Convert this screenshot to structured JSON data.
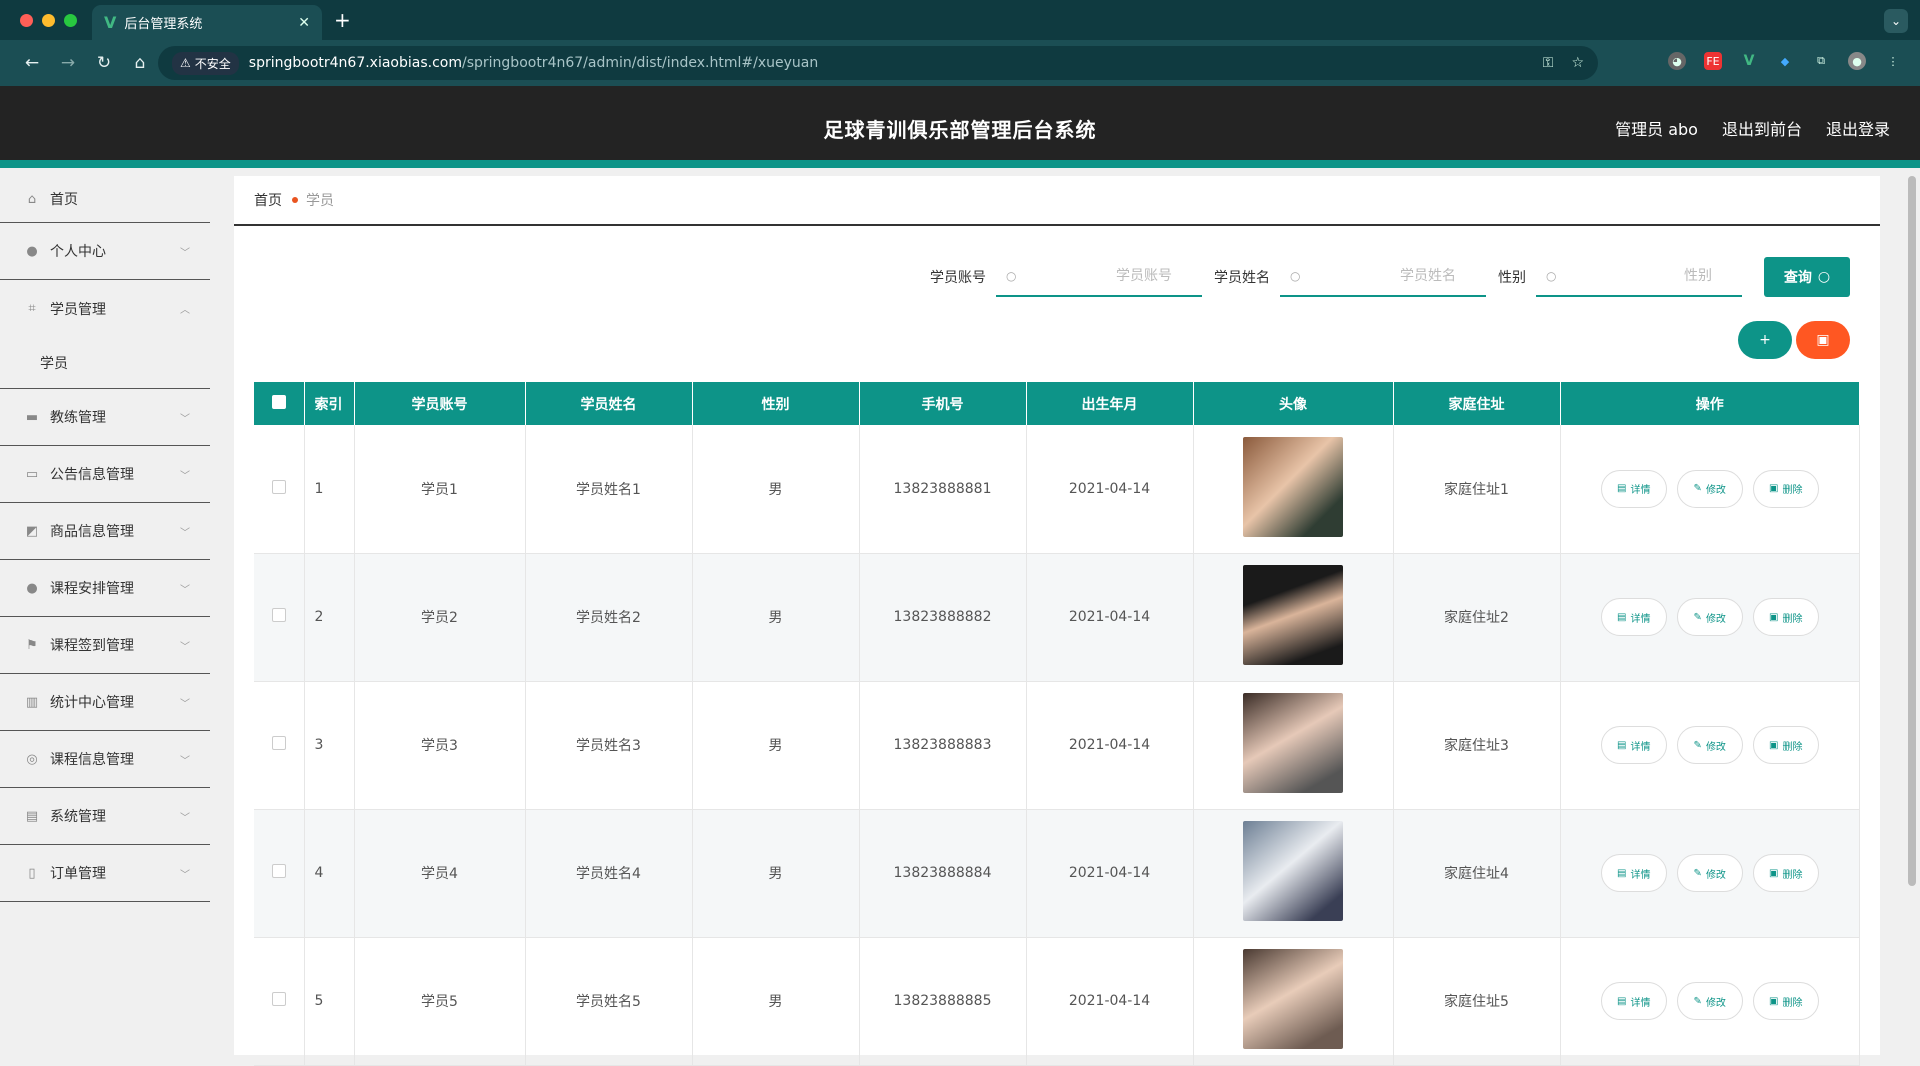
{
  "browser": {
    "tab_title": "后台管理系统",
    "insecure_label": "不安全",
    "url_host": "springbootr4n67.xiaobias.com",
    "url_path": "/springbootr4n67/admin/dist/index.html#/xueyuan"
  },
  "header": {
    "title": "足球青训俱乐部管理后台系统",
    "admin_label": "管理员 abo",
    "to_front": "退出到前台",
    "logout": "退出登录"
  },
  "sidebar": {
    "home": "首页",
    "personal": "个人中心",
    "student_mgmt": "学员管理",
    "student_sub": "学员",
    "coach": "教练管理",
    "notice": "公告信息管理",
    "goods": "商品信息管理",
    "course_schedule": "课程安排管理",
    "checkin": "课程签到管理",
    "stats": "统计中心管理",
    "course_info": "课程信息管理",
    "system": "系统管理",
    "orders": "订单管理"
  },
  "breadcrumb": {
    "home": "首页",
    "current": "学员"
  },
  "search": {
    "account_label": "学员账号",
    "account_placeholder": "学员账号",
    "name_label": "学员姓名",
    "name_placeholder": "学员姓名",
    "gender_label": "性别",
    "gender_placeholder": "性别",
    "query_label": "查询"
  },
  "colors": {
    "accent": "#0d9488",
    "danger": "#ff5722",
    "header_bg": "#232323"
  },
  "table": {
    "headers": [
      "索引",
      "学员账号",
      "学员姓名",
      "性别",
      "手机号",
      "出生年月",
      "头像",
      "家庭住址",
      "操作"
    ],
    "ops": {
      "detail": "详情",
      "edit": "修改",
      "delete": "删除"
    },
    "rows": [
      {
        "idx": "1",
        "account": "学员1",
        "name": "学员姓名1",
        "gender": "男",
        "phone": "13823888881",
        "birth": "2021-04-14",
        "address": "家庭住址1"
      },
      {
        "idx": "2",
        "account": "学员2",
        "name": "学员姓名2",
        "gender": "男",
        "phone": "13823888882",
        "birth": "2021-04-14",
        "address": "家庭住址2"
      },
      {
        "idx": "3",
        "account": "学员3",
        "name": "学员姓名3",
        "gender": "男",
        "phone": "13823888883",
        "birth": "2021-04-14",
        "address": "家庭住址3"
      },
      {
        "idx": "4",
        "account": "学员4",
        "name": "学员姓名4",
        "gender": "男",
        "phone": "13823888884",
        "birth": "2021-04-14",
        "address": "家庭住址4"
      },
      {
        "idx": "5",
        "account": "学员5",
        "name": "学员姓名5",
        "gender": "男",
        "phone": "13823888885",
        "birth": "2021-04-14",
        "address": "家庭住址5"
      }
    ]
  }
}
